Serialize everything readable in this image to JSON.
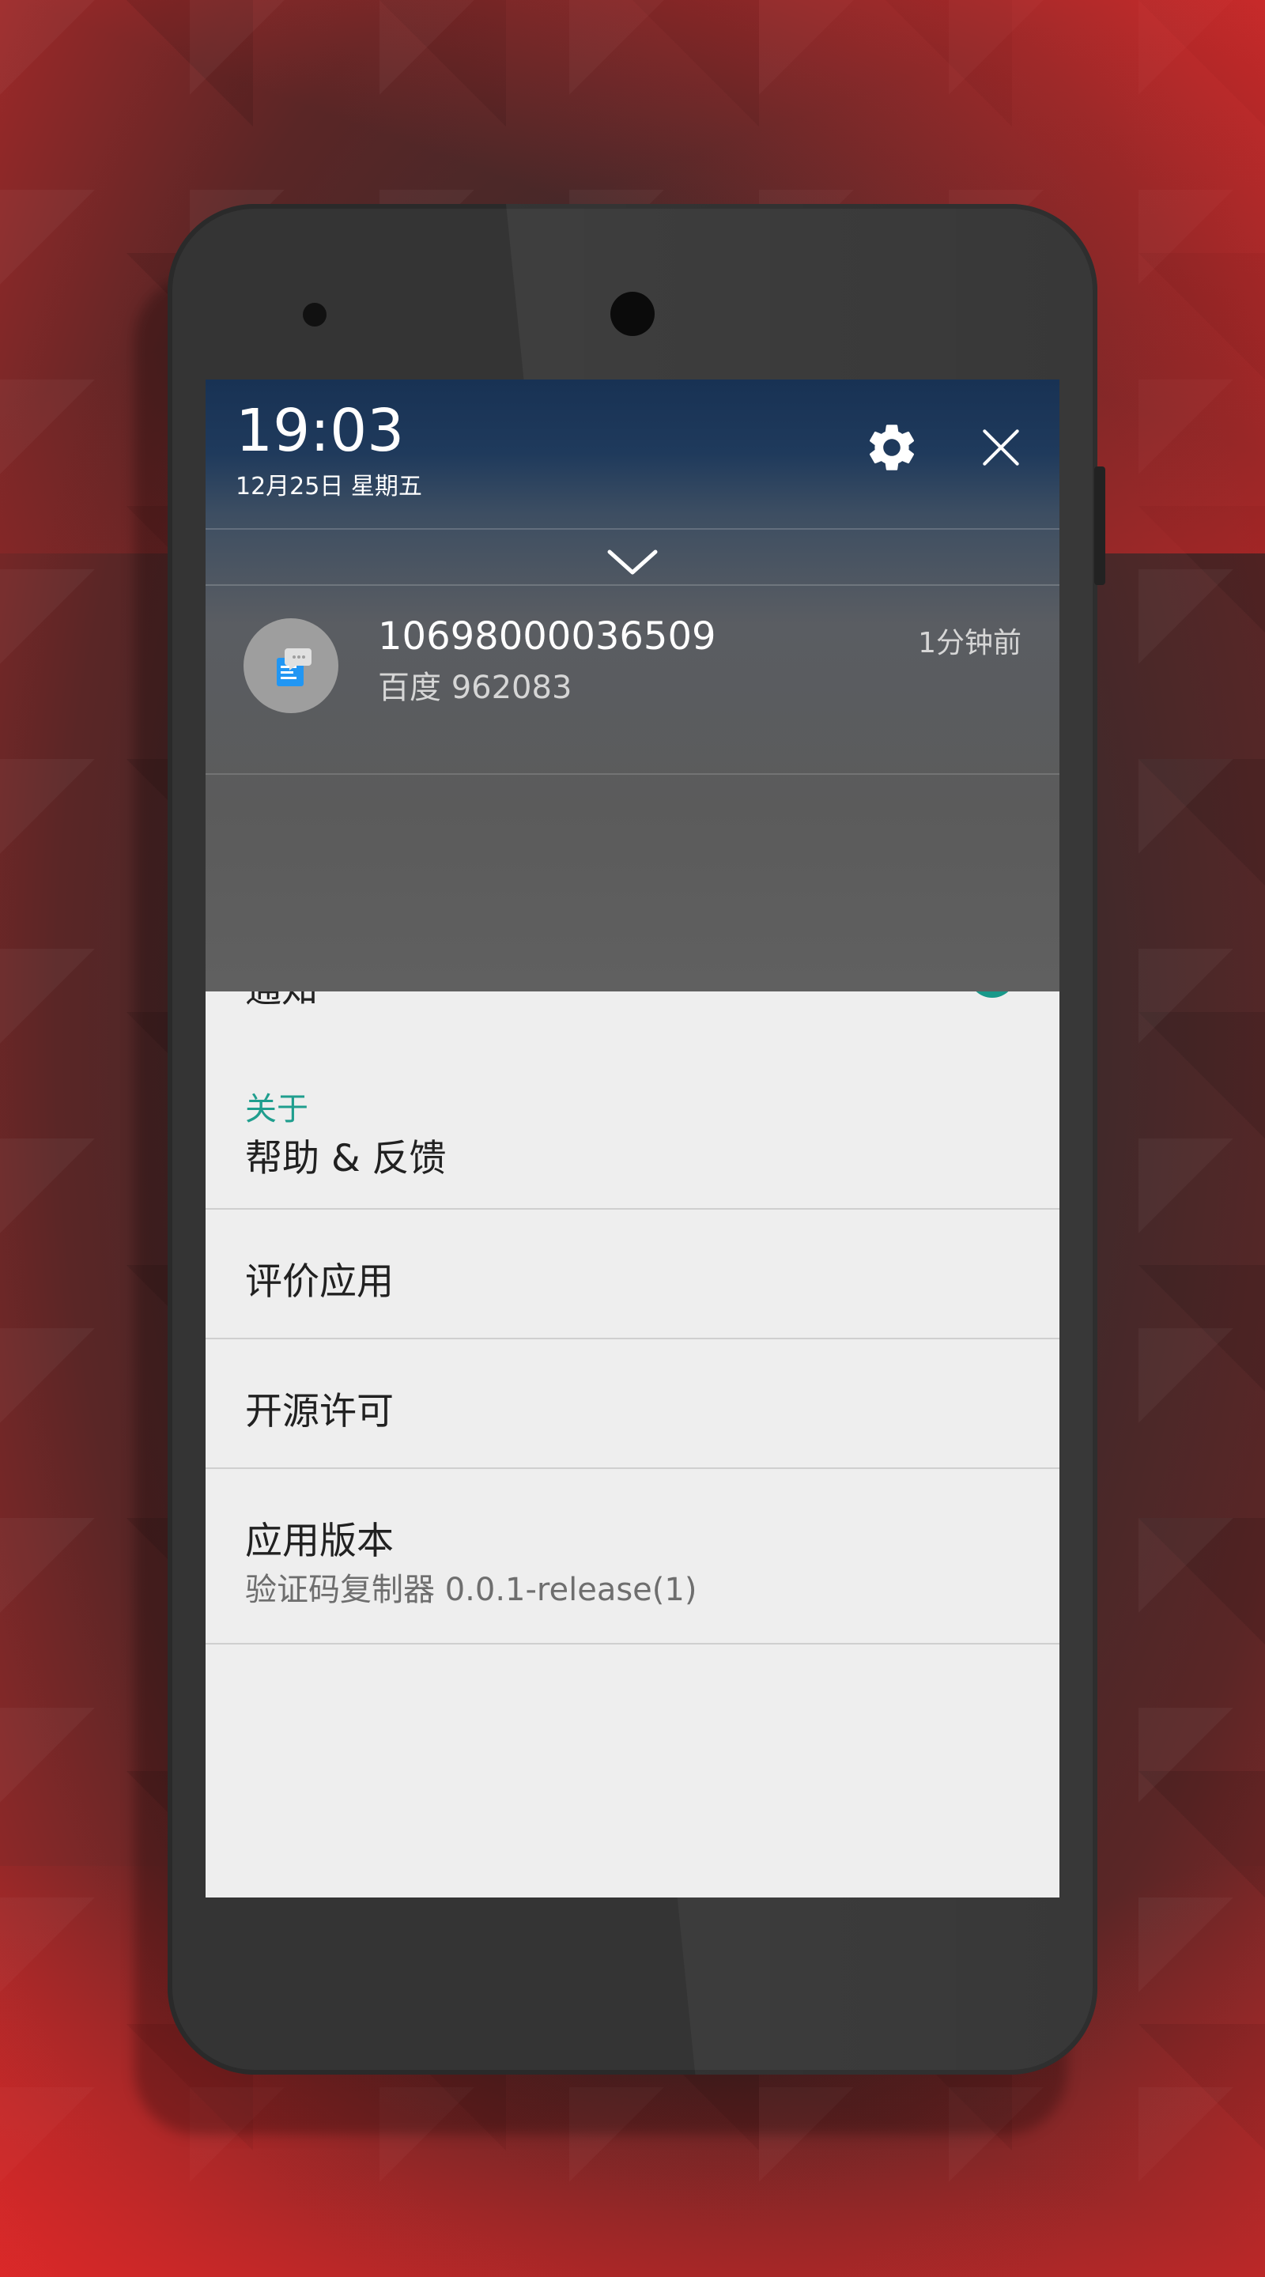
{
  "status": {
    "time": "19:03",
    "date": "12月25日 星期五"
  },
  "shade": {
    "icons": {
      "settings": "gear-icon",
      "close": "close-icon",
      "expand": "chevron-down-icon",
      "app": "sms-message-icon"
    }
  },
  "notification": {
    "sender": "10698000036509",
    "message": "百度 962083",
    "time": "1分钟前"
  },
  "settings_page": {
    "section_about": "关于",
    "items": [
      {
        "title": "帮助 & 反馈",
        "summary": ""
      },
      {
        "title": "评价应用",
        "summary": ""
      },
      {
        "title": "开源许可",
        "summary": ""
      },
      {
        "title": "应用版本",
        "summary": "验证码复制器 0.0.1-release(1)"
      }
    ]
  },
  "colors": {
    "accent": "#1f9e8e",
    "shade_top": "#183254",
    "screen_bg": "#eeeeee"
  }
}
